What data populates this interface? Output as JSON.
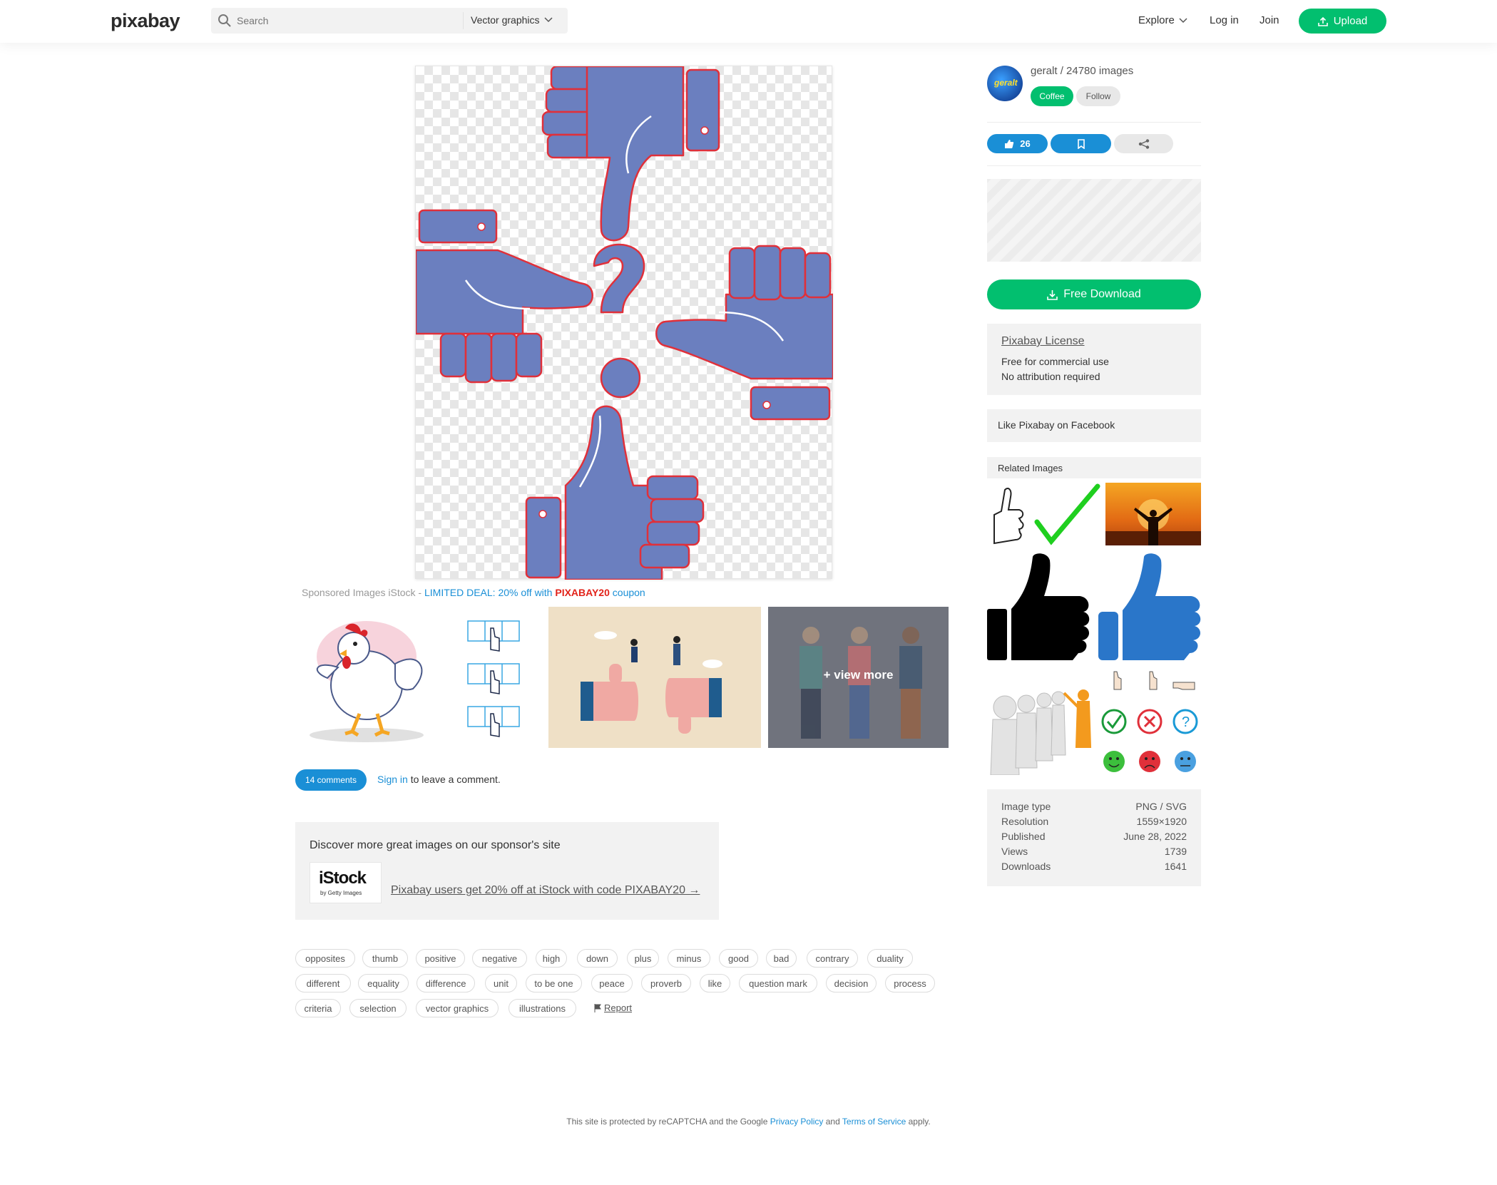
{
  "header": {
    "logo": "pixabay",
    "search_placeholder": "Search",
    "search_scope": "Vector graphics",
    "explore": "Explore",
    "login": "Log in",
    "join": "Join",
    "upload": "Upload"
  },
  "sponsored": {
    "prefix": "Sponsored Images iStock - ",
    "deal": "LIMITED DEAL: 20% off with ",
    "code": "PIXABAY20",
    "suffix": " coupon",
    "view_more": "+ view more"
  },
  "comments": {
    "count_label": "14 comments",
    "sign_in": "Sign in",
    "rest": " to leave a comment."
  },
  "sponsor_box": {
    "title": "Discover more great images on our sponsor's site",
    "logo_big": "iStock",
    "logo_small": "by Getty Images",
    "link": "Pixabay users get 20% off at iStock with code PIXABAY20 →"
  },
  "tags": [
    "opposites",
    "thumb",
    "positive",
    "negative",
    "high",
    "down",
    "plus",
    "minus",
    "good",
    "bad",
    "contrary",
    "duality",
    "different",
    "equality",
    "difference",
    "unit",
    "to be one",
    "peace",
    "proverb",
    "like",
    "question mark",
    "decision",
    "process",
    "criteria",
    "selection",
    "vector graphics",
    "illustrations"
  ],
  "report": "Report",
  "footer": {
    "pre": "This site is protected by reCAPTCHA and the Google ",
    "privacy": "Privacy Policy",
    "mid": " and ",
    "terms": "Terms of Service",
    "post": " apply."
  },
  "author": {
    "name_line": "geralt / 24780 images",
    "avatar_text": "geralt",
    "coffee": "Coffee",
    "follow": "Follow"
  },
  "actions": {
    "likes": "26"
  },
  "download": "Free Download",
  "license": {
    "title": "Pixabay License",
    "line1": "Free for commercial use",
    "line2": "No attribution required"
  },
  "facebook": "Like Pixabay on Facebook",
  "related_title": "Related Images",
  "info": [
    {
      "label": "Image type",
      "value": "PNG / SVG"
    },
    {
      "label": "Resolution",
      "value": "1559×1920"
    },
    {
      "label": "Published",
      "value": "June 28, 2022"
    },
    {
      "label": "Views",
      "value": "1739"
    },
    {
      "label": "Downloads",
      "value": "1641"
    }
  ],
  "colors": {
    "brand_green": "#02bf6f",
    "accent_blue": "#1a8fd6",
    "hand_fill": "#6b7fbf",
    "hand_stroke": "#e0303a"
  },
  "icons": {
    "search": "search-icon",
    "upload": "upload-icon",
    "like": "thumbs-up-icon",
    "save": "bookmark-icon",
    "share": "share-icon",
    "download": "download-icon",
    "report": "flag-icon"
  }
}
